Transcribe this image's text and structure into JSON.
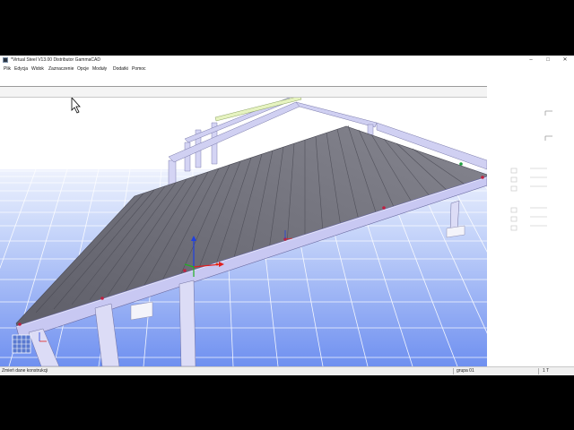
{
  "window": {
    "title": "*Virtual Steel V13.00 Distributor GammaCAD",
    "controls": {
      "minimize": "–",
      "maximize": "□",
      "close": "✕"
    }
  },
  "menu": [
    "Plik",
    "Edycja",
    "Widok",
    "Zaznaczenie",
    "Opcje",
    "Moduły",
    "Dodatki",
    "Pomoc"
  ],
  "statusbar": {
    "message": "Zmień dane konstrukcji",
    "group": "grupa 01",
    "unit": "1 T"
  },
  "icons": {
    "app": "app-icon",
    "cursor": "arrow-cursor-icon",
    "axes": "xyz-axes-gizmo-icon",
    "view_cube": "view-cube-icon"
  },
  "colors": {
    "grid_lines": "#ffffff",
    "floor_far": "#dfe7fb",
    "floor_near": "#6f90f0",
    "steel_members": "#c8c8f2",
    "roof_sheeting": "#6e6e78",
    "axis_x": "#e02020",
    "axis_y": "#20b020",
    "axis_z": "#2040e0"
  }
}
